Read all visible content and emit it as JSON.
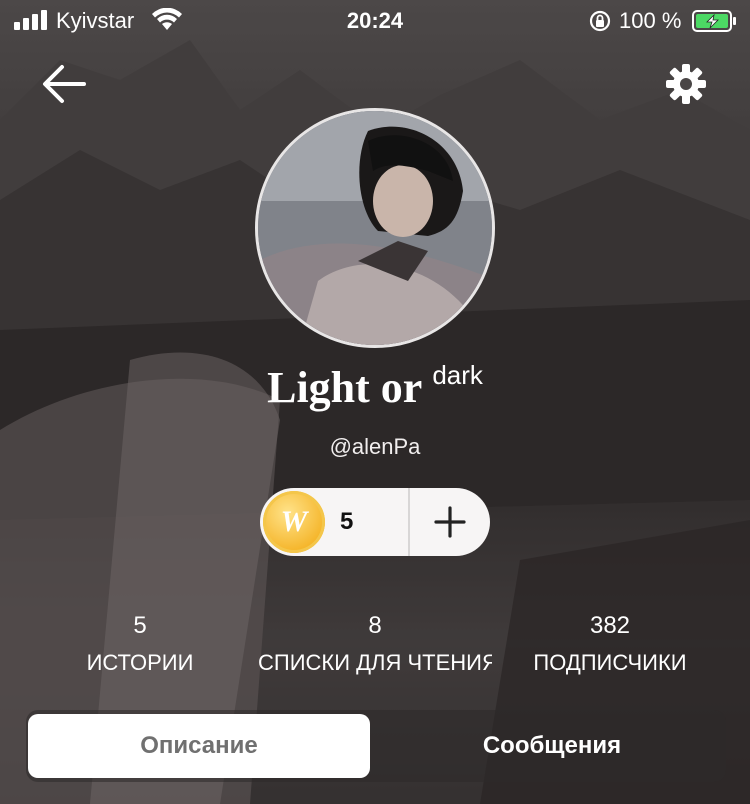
{
  "status_bar": {
    "carrier": "Kyivstar",
    "time": "20:24",
    "battery_percent": "100 %"
  },
  "header": {
    "back_icon": "arrow-left-icon",
    "settings_icon": "gear-icon"
  },
  "profile": {
    "display_name": "Light or",
    "display_name_sup": "dark",
    "username": "@alenPa"
  },
  "coins": {
    "icon_letter": "W",
    "count": "5",
    "add_icon": "plus-icon",
    "coin_color": "#f5b62c"
  },
  "stats": [
    {
      "value": "5",
      "label": "ИСТОРИИ"
    },
    {
      "value": "8",
      "label": "СПИСКИ ДЛЯ ЧТЕНИЯ"
    },
    {
      "value": "382",
      "label": "ПОДПИСЧИКИ"
    }
  ],
  "tabs": [
    {
      "label": "Описание",
      "active": true
    },
    {
      "label": "Сообщения",
      "active": false
    }
  ]
}
